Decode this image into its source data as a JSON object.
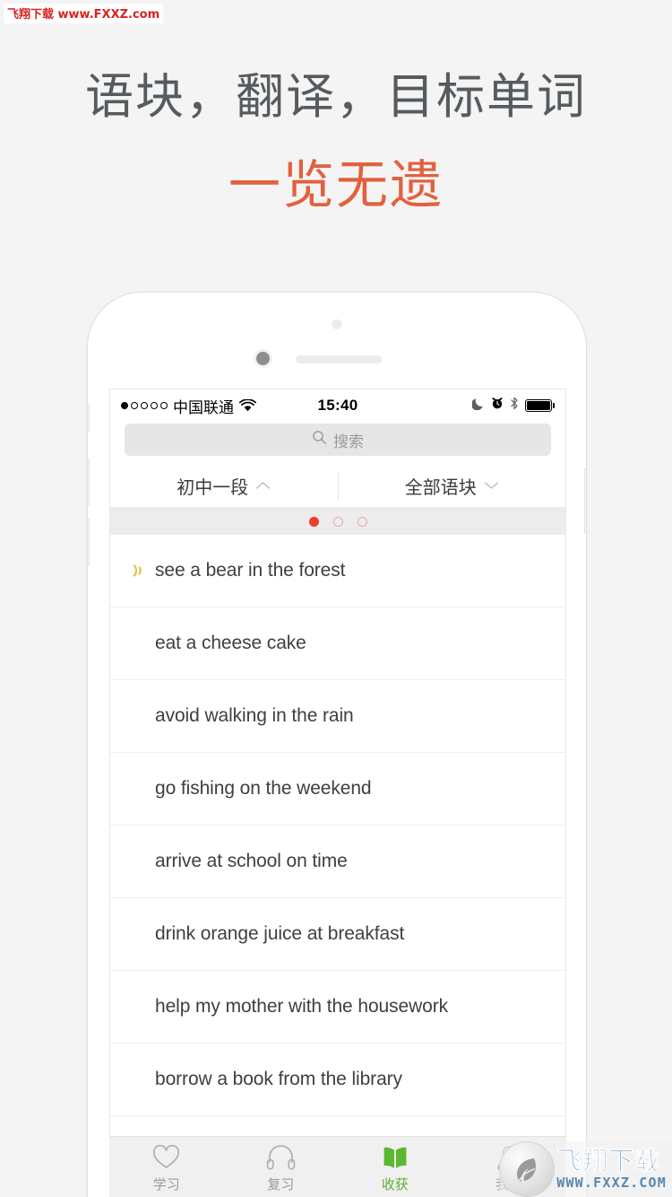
{
  "watermarks": {
    "top": "飞翔下载 www.FXXZ.com",
    "bottom_cn": "飞翔下载",
    "bottom_en": "WWW.FXXZ.COM",
    "logo_icon": "feather-circle-logo-icon"
  },
  "headline": {
    "line1": "语块，翻译，目标单词",
    "line2": "一览无遗",
    "line1_color": "#555b5e",
    "line2_color": "#e2613e"
  },
  "phone": {
    "camera_icon": "front-camera-icon",
    "speaker_icon": "earpiece-speaker-icon",
    "sensor_icon": "proximity-sensor-icon"
  },
  "statusbar": {
    "signal_dots_total": 5,
    "signal_dots_filled": 1,
    "carrier": "中国联通",
    "wifi_icon": "wifi-icon",
    "time": "15:40",
    "dnd_icon": "moon-do-not-disturb-icon",
    "alarm_icon": "alarm-clock-icon",
    "bluetooth_icon": "bluetooth-icon",
    "battery_icon": "battery-full-icon"
  },
  "search": {
    "placeholder": "搜索",
    "icon": "search-icon"
  },
  "filters": [
    {
      "label": "初中一段",
      "chevron": "chevron-up-icon",
      "direction": "up"
    },
    {
      "label": "全部语块",
      "chevron": "chevron-down-icon",
      "direction": "down"
    }
  ],
  "pager": {
    "total": 3,
    "active_index": 0,
    "active_color": "#ee3b2c",
    "idle_border_color": "#eeaaa4"
  },
  "list": {
    "rows": [
      {
        "text": "see a bear in the forest",
        "icon": "sound-wave-icon",
        "has_icon": true
      },
      {
        "text": "eat a cheese cake",
        "icon": "",
        "has_icon": false
      },
      {
        "text": "avoid walking in the rain",
        "icon": "",
        "has_icon": false
      },
      {
        "text": "go fishing on the weekend",
        "icon": "",
        "has_icon": false
      },
      {
        "text": "arrive at school on time",
        "icon": "",
        "has_icon": false
      },
      {
        "text": "drink orange juice at breakfast",
        "icon": "",
        "has_icon": false
      },
      {
        "text": "help my mother with the housework",
        "icon": "",
        "has_icon": false
      },
      {
        "text": "borrow a book from the library",
        "icon": "",
        "has_icon": false
      }
    ]
  },
  "tabbar": {
    "active_color": "#57b030",
    "inactive_color": "#9a9a9a",
    "tabs": [
      {
        "label": "学习",
        "icon": "heart-icon",
        "active": false
      },
      {
        "label": "复习",
        "icon": "headphones-icon",
        "active": false
      },
      {
        "label": "收获",
        "icon": "open-book-icon",
        "active": true
      },
      {
        "label": "我的",
        "icon": "person-icon",
        "active": false
      }
    ]
  }
}
